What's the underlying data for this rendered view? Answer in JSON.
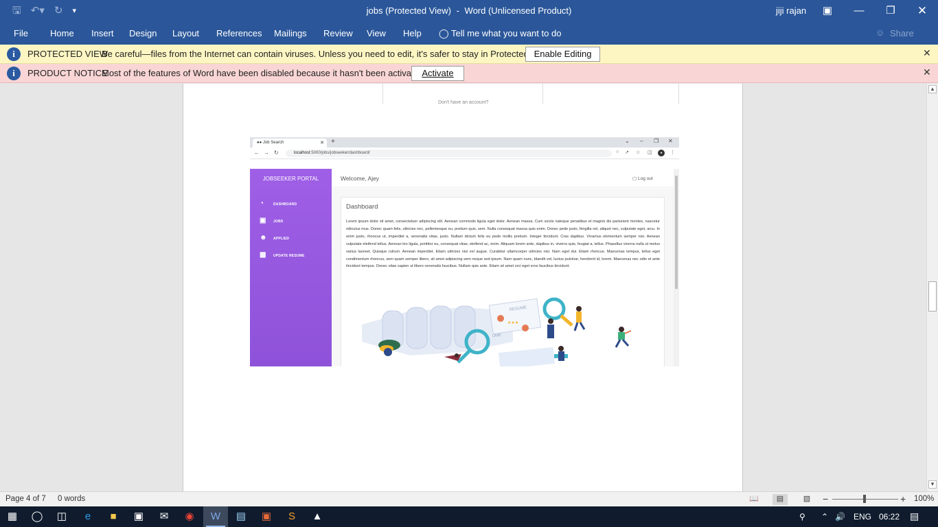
{
  "window": {
    "doc_name": "jobs (Protected View)",
    "separator": "-",
    "app_name": "Word (Unlicensed Product)",
    "user": "jiji rajan",
    "accent": "#2b579a"
  },
  "ribbon": {
    "tabs": [
      "File",
      "Home",
      "Insert",
      "Design",
      "Layout",
      "References",
      "Mailings",
      "Review",
      "View",
      "Help"
    ],
    "tell_me": "Tell me what you want to do",
    "share": "Share"
  },
  "protected_view": {
    "label": "PROTECTED VIEW",
    "message": "Be careful—files from the Internet can contain viruses. Unless you need to edit, it's safer to stay in Protected View.",
    "button": "Enable Editing",
    "color": "#fdf6c3"
  },
  "product_notice": {
    "label": "PRODUCT NOTICE",
    "message": "Most of the features of Word have been disabled because it hasn't been activated.",
    "button": "Activate",
    "color": "#f9d6d5"
  },
  "document": {
    "previous_image_text": "Don't have an account?",
    "browser": {
      "tab_title": "Job Search",
      "url_host": "localhost",
      "url_path": ":5000/jobs/jobseeker/dashboard/"
    },
    "portal": {
      "brand": "JOBSEEKER PORTAL",
      "menu": [
        {
          "label": "DASHBOARD",
          "icon": "dashboard-icon"
        },
        {
          "label": "JOBS",
          "icon": "briefcase-icon"
        },
        {
          "label": "APPLIED",
          "icon": "user-icon"
        },
        {
          "label": "UPDATE RESUME",
          "icon": "pdf-file-icon"
        }
      ],
      "welcome": "Welcome, Ajey",
      "logout": "Log out",
      "card_title": "Dashboard",
      "card_text": "Lorem ipsum dolor sit amet, consectetuer adipiscing elit. Aenean commodo ligula eget dolor. Aenean massa. Cum sociis natoque penatibus et magnis dis parturient montes, nascetur ridiculus mus. Donec quam felis, ultricies nec, pellentesque eu, pretium quis, sem. Nulla consequat massa quis enim. Donec pede justo, fringilla vel, aliquet nec, vulputate eget, arcu. In enim justo, rhoncus ut, imperdiet a, venenatis vitae, justo. Nullam dictum felis eu pede mollis pretium. Integer tincidunt. Cras dapibus. Vivamus elementum semper nisi. Aenean vulputate eleifend tellus. Aenean leo ligula, porttitor eu, consequat vitae, eleifend ac, enim. Aliquam lorem ante, dapibus in, viverra quis, feugiat a, tellus. Phasellus viverra nulla ut metus varius laoreet. Quisque rutrum. Aenean imperdiet. Etiam ultricies nisi vel augue. Curabitur ullamcorper ultricies nisi. Nam eget dui. Etiam rhoncus. Maecenas tempus, tellus eget condimentum rhoncus, sem quam semper libero, sit amet adipiscing sem neque sed ipsum. Nam quam nunc, blandit vel, luctus pulvinar, hendrerit id, lorem. Maecenas nec odio et ante tincidunt tempus. Donec vitae sapien ut libero venenatis faucibus. Nullam quis ante. Etiam sit amet orci eget eros faucibus tincidunt.",
      "illustration_text": "RESUME",
      "sidebar_color": "#9f5fe6"
    }
  },
  "status": {
    "page": "Page 4 of 7",
    "words": "0 words",
    "zoom": "100%",
    "zoom_minus": "−",
    "zoom_plus": "+"
  },
  "taskbar": {
    "lang": "ENG",
    "time": "06:22"
  }
}
